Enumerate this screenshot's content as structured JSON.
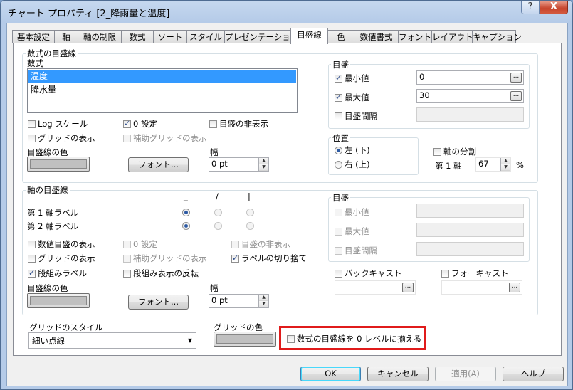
{
  "window": {
    "title": "チャート プロパティ [2_降雨量と温度]",
    "help_glyph": "?",
    "close_glyph": "X"
  },
  "tabs": [
    "基本設定",
    "軸",
    "軸の制限",
    "数式",
    "ソート",
    "スタイル",
    "プレゼンテーション",
    "目盛線",
    "色",
    "数値書式",
    "フォント",
    "レイアウト",
    "キャプション"
  ],
  "expr_grid": {
    "group_label": "数式の目盛線",
    "list_label": "数式",
    "expressions": [
      "温度",
      "降水量"
    ],
    "log_scale": "Log スケール",
    "zero_setting": "0 設定",
    "hide_scale": "目盛の非表示",
    "show_grid": "グリッドの表示",
    "sub_grid": "補助グリッドの表示",
    "line_color_label": "目盛線の色",
    "font_button": "フォント...",
    "width_label": "幅",
    "width_value": "0 pt",
    "scale": {
      "group_label": "目盛",
      "min_label": "最小値",
      "min_value": "0",
      "max_label": "最大値",
      "max_value": "30",
      "interval_label": "目盛間隔",
      "ellipsis": "..."
    },
    "position": {
      "group_label": "位置",
      "left": "左 (下)",
      "right": "右 (上)"
    },
    "split": {
      "label": "軸の分割",
      "primary_label": "第 1 軸",
      "value": "67",
      "unit": "%"
    }
  },
  "dim_grid": {
    "group_label": "軸の目盛線",
    "orient_headers": [
      "_",
      "/",
      "|"
    ],
    "axis1_label": "第 1 軸ラベル",
    "axis2_label": "第 2 軸ラベル",
    "show_numeric": "数値目盛の表示",
    "zero_setting": "0 設定",
    "hide_scale": "目盛の非表示",
    "show_grid": "グリッドの表示",
    "sub_grid": "補助グリッドの表示",
    "truncate_labels": "ラベルの切り捨て",
    "staggered_labels": "段組みラベル",
    "reverse_stagger": "段組み表示の反転",
    "line_color_label": "目盛線の色",
    "font_button": "フォント...",
    "width_label": "幅",
    "width_value": "0 pt",
    "scale": {
      "group_label": "目盛",
      "min_label": "最小値",
      "max_label": "最大値",
      "interval_label": "目盛間隔"
    },
    "backcast": "バックキャスト",
    "forecast": "フォーキャスト",
    "ellipsis": "..."
  },
  "grid_style": {
    "label": "グリッドのスタイル",
    "value": "細い点線"
  },
  "grid_color": {
    "label": "グリッドの色"
  },
  "align_zero": "数式の目盛線を 0 レベルに揃える",
  "buttons": {
    "ok": "OK",
    "cancel": "キャンセル",
    "apply": "適用(A)",
    "help": "ヘルプ"
  },
  "colors": {
    "selection": "#3399ff",
    "highlight": "#e01b1b"
  }
}
